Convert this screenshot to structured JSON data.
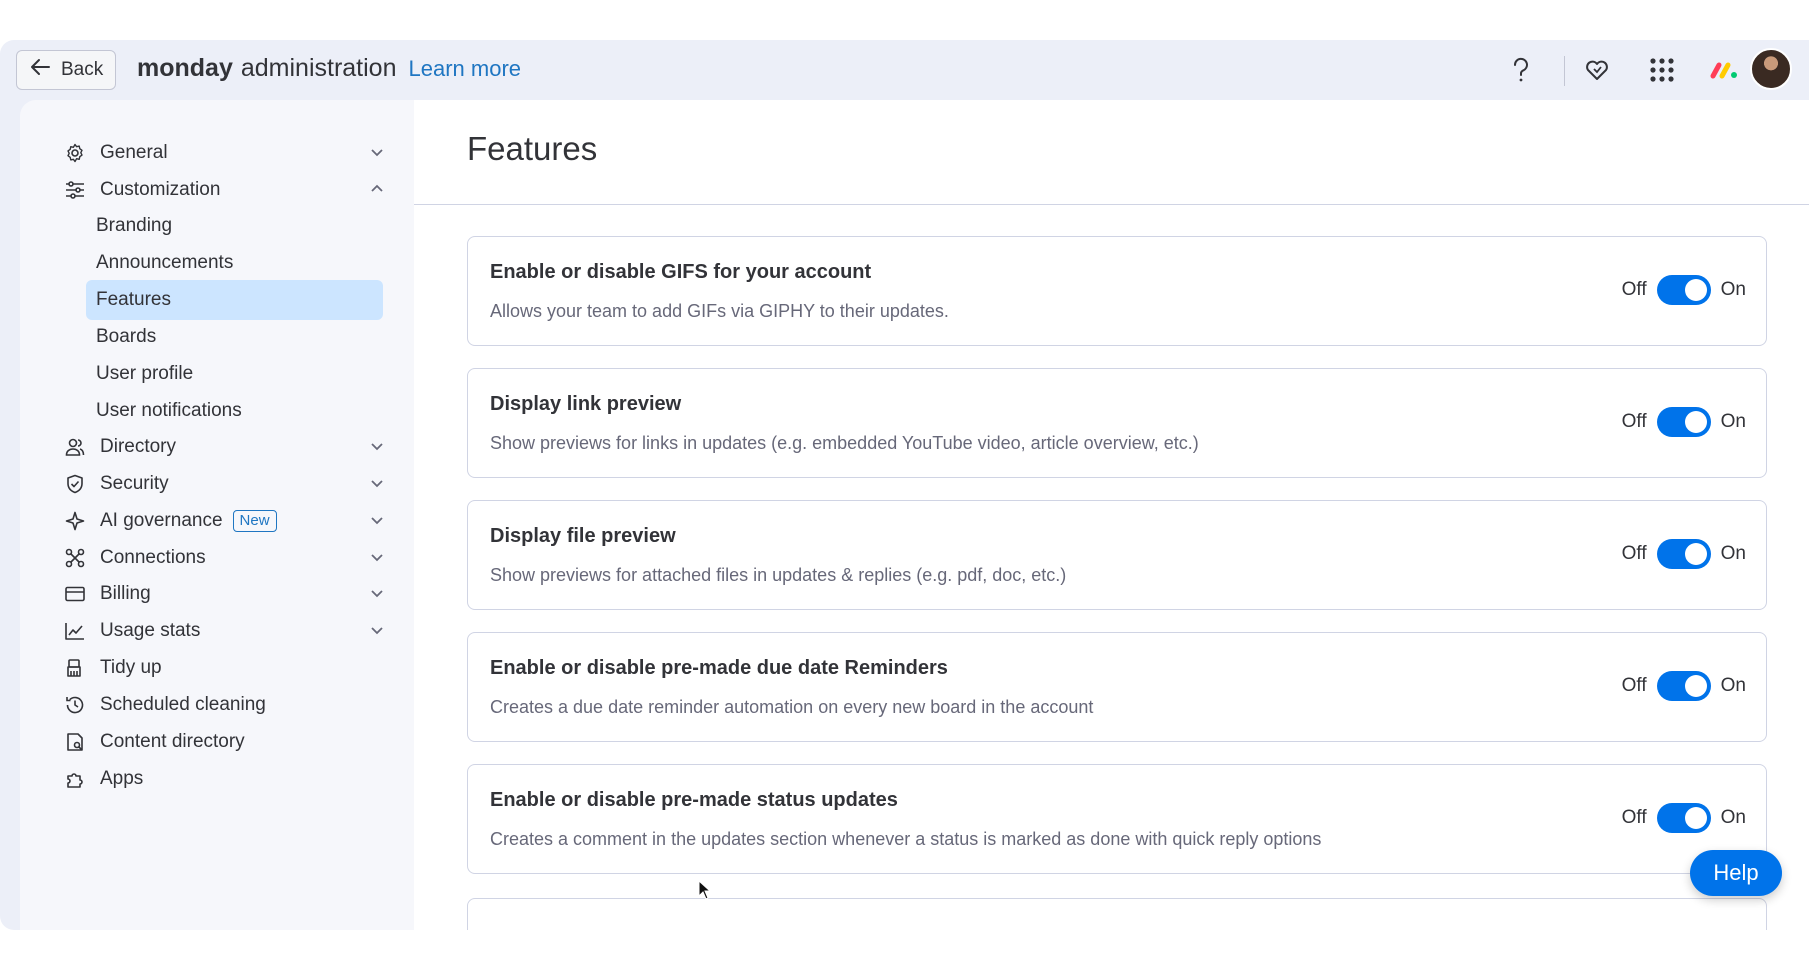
{
  "topbar": {
    "back_label": "Back",
    "brand_bold": "monday",
    "brand_rest": "administration",
    "learn_more": "Learn more",
    "icons": [
      "help-icon",
      "heart-icon",
      "apps-grid-icon",
      "monday-logo-icon"
    ]
  },
  "sidebar": {
    "items": [
      {
        "label": "General",
        "icon": "gear-icon",
        "expanded": false
      },
      {
        "label": "Customization",
        "icon": "sliders-icon",
        "expanded": true
      },
      {
        "label": "Directory",
        "icon": "users-icon",
        "expanded": false
      },
      {
        "label": "Security",
        "icon": "shield-icon",
        "expanded": false
      },
      {
        "label": "AI governance",
        "icon": "sparkle-icon",
        "badge": "New",
        "expanded": false
      },
      {
        "label": "Connections",
        "icon": "connections-icon",
        "expanded": false
      },
      {
        "label": "Billing",
        "icon": "card-icon",
        "expanded": false
      },
      {
        "label": "Usage stats",
        "icon": "chart-icon",
        "expanded": false
      },
      {
        "label": "Tidy up",
        "icon": "broom-icon"
      },
      {
        "label": "Scheduled cleaning",
        "icon": "clock-icon"
      },
      {
        "label": "Content directory",
        "icon": "folder-icon"
      },
      {
        "label": "Apps",
        "icon": "puzzle-icon"
      }
    ],
    "customization_sub": [
      "Branding",
      "Announcements",
      "Features",
      "Boards",
      "User profile",
      "User notifications"
    ],
    "active_sub": "Features"
  },
  "main": {
    "title": "Features",
    "off_label": "Off",
    "on_label": "On",
    "features": [
      {
        "title": "Enable or disable GIFS for your account",
        "desc": "Allows your team to add GIFs via GIPHY to their updates.",
        "enabled": true
      },
      {
        "title": "Display link preview",
        "desc": "Show previews for links in updates (e.g. embedded YouTube video, article overview, etc.)",
        "enabled": true
      },
      {
        "title": "Display file preview",
        "desc": "Show previews for attached files in updates & replies (e.g. pdf, doc, etc.)",
        "enabled": true
      },
      {
        "title": "Enable or disable pre-made due date Reminders",
        "desc": "Creates a due date reminder automation on every new board in the account",
        "enabled": true
      },
      {
        "title": "Enable or disable pre-made status updates",
        "desc": "Creates a comment in the updates section whenever a status is marked as done with quick reply options",
        "enabled": true
      }
    ]
  },
  "help_label": "Help",
  "colors": {
    "accent": "#0073ea",
    "active_bg": "#cce5ff",
    "link": "#1f76c2"
  }
}
